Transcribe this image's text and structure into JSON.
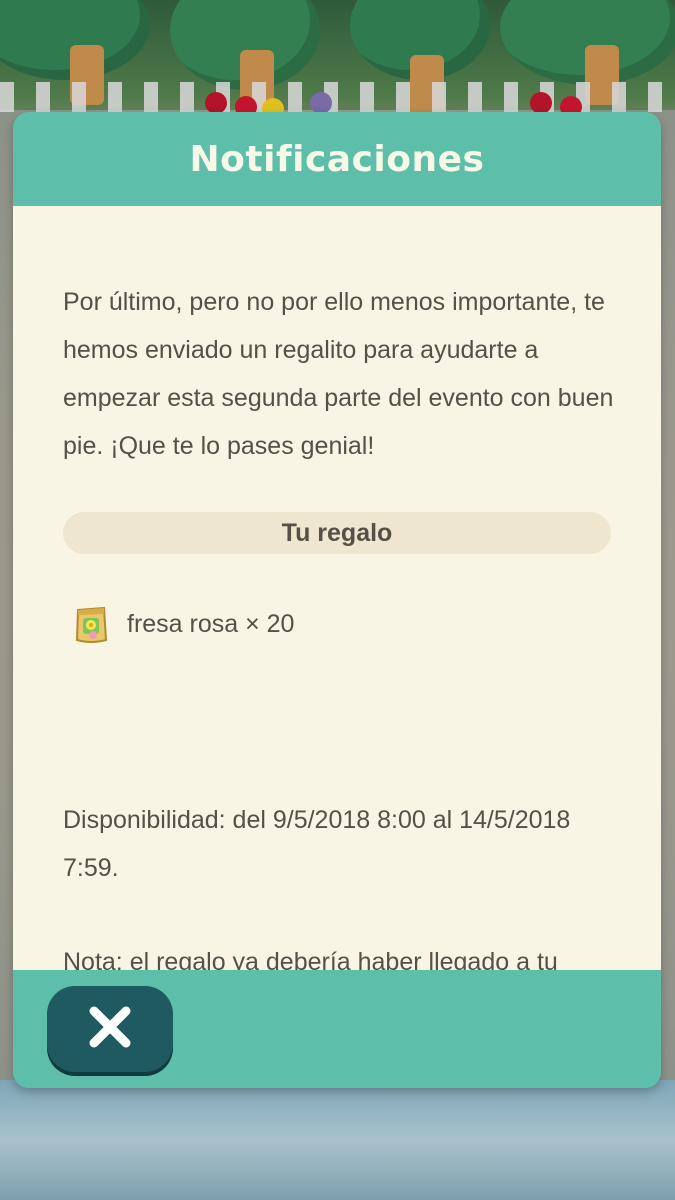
{
  "dialog": {
    "title": "Notificaciones",
    "message": "Por último, pero no por ello menos importante, te hemos enviado un regalito para ayudarte a empezar esta segunda parte del evento con buen pie. ¡Que te lo pases genial!",
    "gift_heading": "Tu regalo",
    "gift_item": "fresa rosa × 20",
    "gift_icon": "seed-bag-icon",
    "availability": "Disponibilidad: del 9/5/2018 8:00 al 14/5/2018 7:59.",
    "note": "Nota: el regalo ya debería haber llegado a tu buzón.",
    "close_icon": "close-icon"
  },
  "colors": {
    "header": "#5dbfaa",
    "body": "#f8f5e4",
    "banner": "#eee6cf",
    "text": "#555048",
    "close_button": "#1e5a60"
  }
}
